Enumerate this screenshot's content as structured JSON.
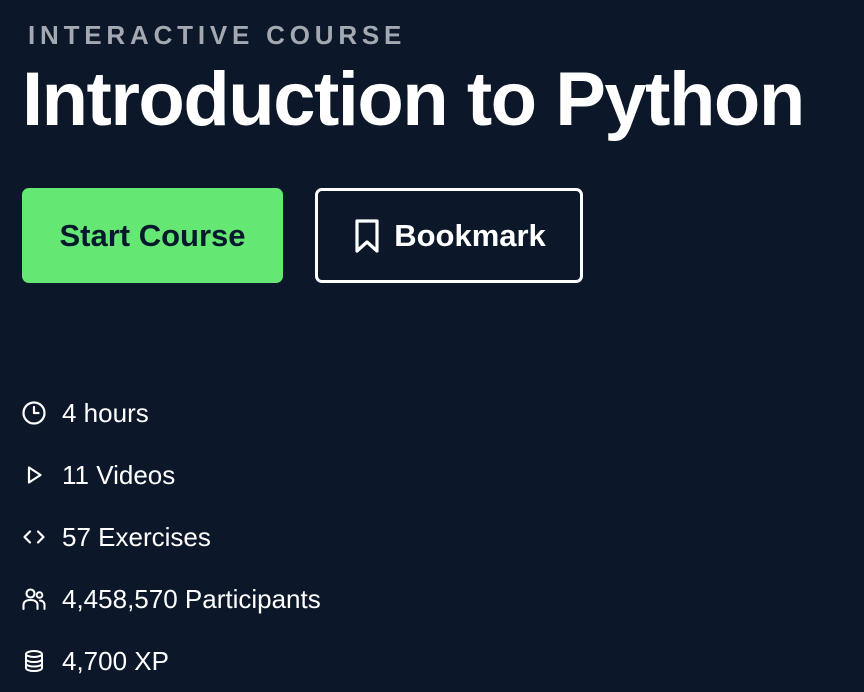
{
  "course": {
    "eyebrow": "INTERACTIVE COURSE",
    "title": "Introduction to Python"
  },
  "actions": {
    "start_label": "Start Course",
    "bookmark_label": "Bookmark",
    "bookmark_icon": "bookmark-icon"
  },
  "stats": [
    {
      "icon": "clock-icon",
      "label": "4 hours"
    },
    {
      "icon": "play-icon",
      "label": "11 Videos"
    },
    {
      "icon": "code-icon",
      "label": "57 Exercises"
    },
    {
      "icon": "participants-icon",
      "label": "4,458,570 Participants"
    },
    {
      "icon": "xp-stack-icon",
      "label": "4,700 XP"
    }
  ],
  "colors": {
    "background": "#0c1829",
    "primary_button": "#65e774",
    "primary_button_text": "#05192d",
    "eyebrow_text": "#a4a9b1",
    "text": "#ffffff"
  }
}
